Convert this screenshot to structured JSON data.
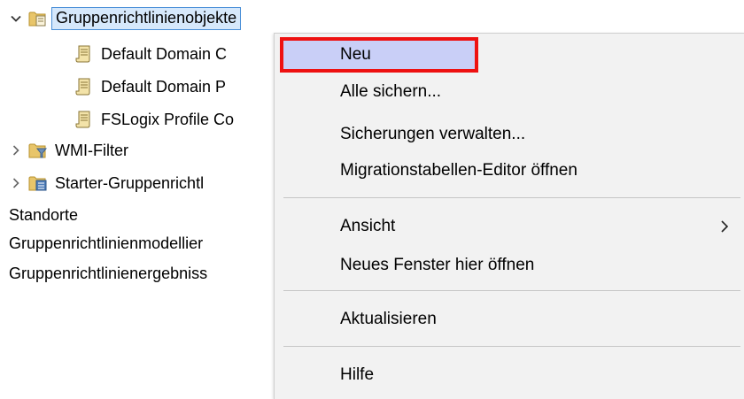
{
  "tree": {
    "items": [
      {
        "label": "Gruppenrichtlinienobjekte",
        "icon": "gpo-folder-icon",
        "expanded": true,
        "selected": true
      },
      {
        "label": "Default Domain C",
        "icon": "scroll-icon"
      },
      {
        "label": "Default Domain P",
        "icon": "scroll-icon"
      },
      {
        "label": "FSLogix Profile Co",
        "icon": "scroll-icon"
      },
      {
        "label": "WMI-Filter",
        "icon": "wmi-folder-icon",
        "expanded": false
      },
      {
        "label": "Starter-Gruppenrichtl",
        "icon": "starter-folder-icon",
        "expanded": false
      },
      {
        "label": "Standorte"
      },
      {
        "label": "Gruppenrichtlinienmodellier"
      },
      {
        "label": "Gruppenrichtlinienergebniss"
      }
    ]
  },
  "context_menu": {
    "items": [
      {
        "label": "Neu",
        "highlighted": true
      },
      {
        "label": "Alle sichern..."
      },
      {
        "label": "Sicherungen verwalten..."
      },
      {
        "label": "Migrationstabellen-Editor öffnen"
      },
      {
        "label": "Ansicht",
        "submenu": true
      },
      {
        "label": "Neues Fenster hier öffnen"
      },
      {
        "label": "Aktualisieren"
      },
      {
        "label": "Hilfe"
      }
    ],
    "highlight_color": "#c9cff7",
    "highlight_border_color": "#ee1111"
  }
}
